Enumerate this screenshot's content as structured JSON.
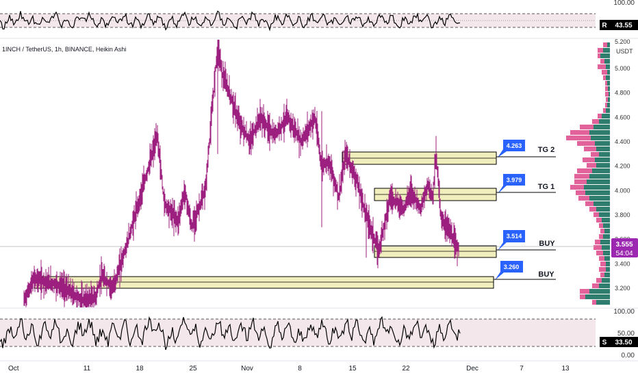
{
  "symbol_line": "1INCH / TetherUS, 1h, BINANCE, Heikin Ashi",
  "currency": "USDT",
  "price_axis": {
    "ticks": [
      "5.000",
      "4.800",
      "4.600",
      "4.400",
      "4.200",
      "4.000",
      "3.800",
      "3.600",
      "3.400",
      "3.200"
    ],
    "top_partial_label": "5.200"
  },
  "time_axis": {
    "labels": [
      "Oct",
      "11",
      "18",
      "25",
      "Nov",
      "8",
      "15",
      "22",
      "Dec",
      "7",
      "13"
    ]
  },
  "top_indicator": {
    "axis_labels": [
      "100.00"
    ],
    "badge_letter": "R",
    "badge_value": "43.55",
    "line_color": "#000000",
    "band_color": "#f3e7ec"
  },
  "bottom_indicator": {
    "axis_labels": [
      "100.00",
      "50.00",
      "0.00"
    ],
    "badge_letter": "S",
    "badge_value": "33.50",
    "line_color": "#000000",
    "band_color": "#f3e7ec"
  },
  "current_price": {
    "value": "3.555",
    "countdown": "54:04",
    "color": "#9c27b0"
  },
  "zones": [
    {
      "tag": "4.263",
      "label": "TG 2"
    },
    {
      "tag": "3.979",
      "label": "TG 1"
    },
    {
      "tag": "3.514",
      "label": "BUY"
    },
    {
      "tag": "3.260",
      "label": "BUY"
    }
  ],
  "colors": {
    "candle": "#9c1f7f",
    "zone_fill": "#f1eebd",
    "tag_bg": "#2962ff",
    "profile_up": "#2e7d6f",
    "profile_down": "#e2639b"
  },
  "chart_data": {
    "type": "line",
    "title": "1INCH / TetherUS, 1h, BINANCE, Heikin Ashi",
    "xlabel": "",
    "ylabel": "USDT",
    "ylim": [
      3.1,
      5.2
    ],
    "x": [
      "Oct 1",
      "Oct 3",
      "Oct 6",
      "Oct 9",
      "Oct 12",
      "Oct 15",
      "Oct 16",
      "Oct 17",
      "Oct 19",
      "Oct 20",
      "Oct 21",
      "Oct 23",
      "Oct 24",
      "Oct 25",
      "Oct 26",
      "Oct 27",
      "Oct 28",
      "Oct 29",
      "Oct 30",
      "Oct 31",
      "Nov 1",
      "Nov 3",
      "Nov 5",
      "Nov 7",
      "Nov 9",
      "Nov 11",
      "Nov 12",
      "Nov 13",
      "Nov 14",
      "Nov 15",
      "Nov 16",
      "Nov 17",
      "Nov 18",
      "Nov 19",
      "Nov 20",
      "Nov 21",
      "Nov 22",
      "Nov 23",
      "Nov 24",
      "Nov 25",
      "Nov 26",
      "Nov 27",
      "Nov 28"
    ],
    "series": [
      {
        "values": [
          3.1,
          3.28,
          3.25,
          3.22,
          3.1,
          3.13,
          3.3,
          3.2,
          3.55,
          4.45,
          3.9,
          3.75,
          4.0,
          3.7,
          4.0,
          5.2,
          4.95,
          4.8,
          4.55,
          4.4,
          4.6,
          4.45,
          4.6,
          4.4,
          4.6,
          4.2,
          4.25,
          3.95,
          4.3,
          4.1,
          3.8,
          3.5,
          3.95,
          3.85,
          4.0,
          3.85,
          4.05,
          3.95,
          4.3,
          3.75,
          3.7,
          3.55,
          3.52
        ]
      }
    ],
    "zones": [
      {
        "name": "TG 2",
        "low": 4.235,
        "high": 4.315,
        "start": "Nov 14",
        "end": "Dec 4"
      },
      {
        "name": "TG 1",
        "low": 3.92,
        "high": 4.015,
        "start": "Nov 19",
        "end": "Dec 4"
      },
      {
        "name": "BUY",
        "low": 3.465,
        "high": 3.555,
        "start": "Nov 19",
        "end": "Dec 4"
      },
      {
        "name": "BUY",
        "low": 3.215,
        "high": 3.29,
        "start": "Oct 2",
        "end": "Dec 4"
      }
    ],
    "current_price": 3.555,
    "grid": false,
    "indicators": [
      {
        "name": "R",
        "range": [
          0,
          100
        ],
        "last": 43.55
      },
      {
        "name": "S",
        "range": [
          0,
          100
        ],
        "last": 33.5
      }
    ]
  }
}
